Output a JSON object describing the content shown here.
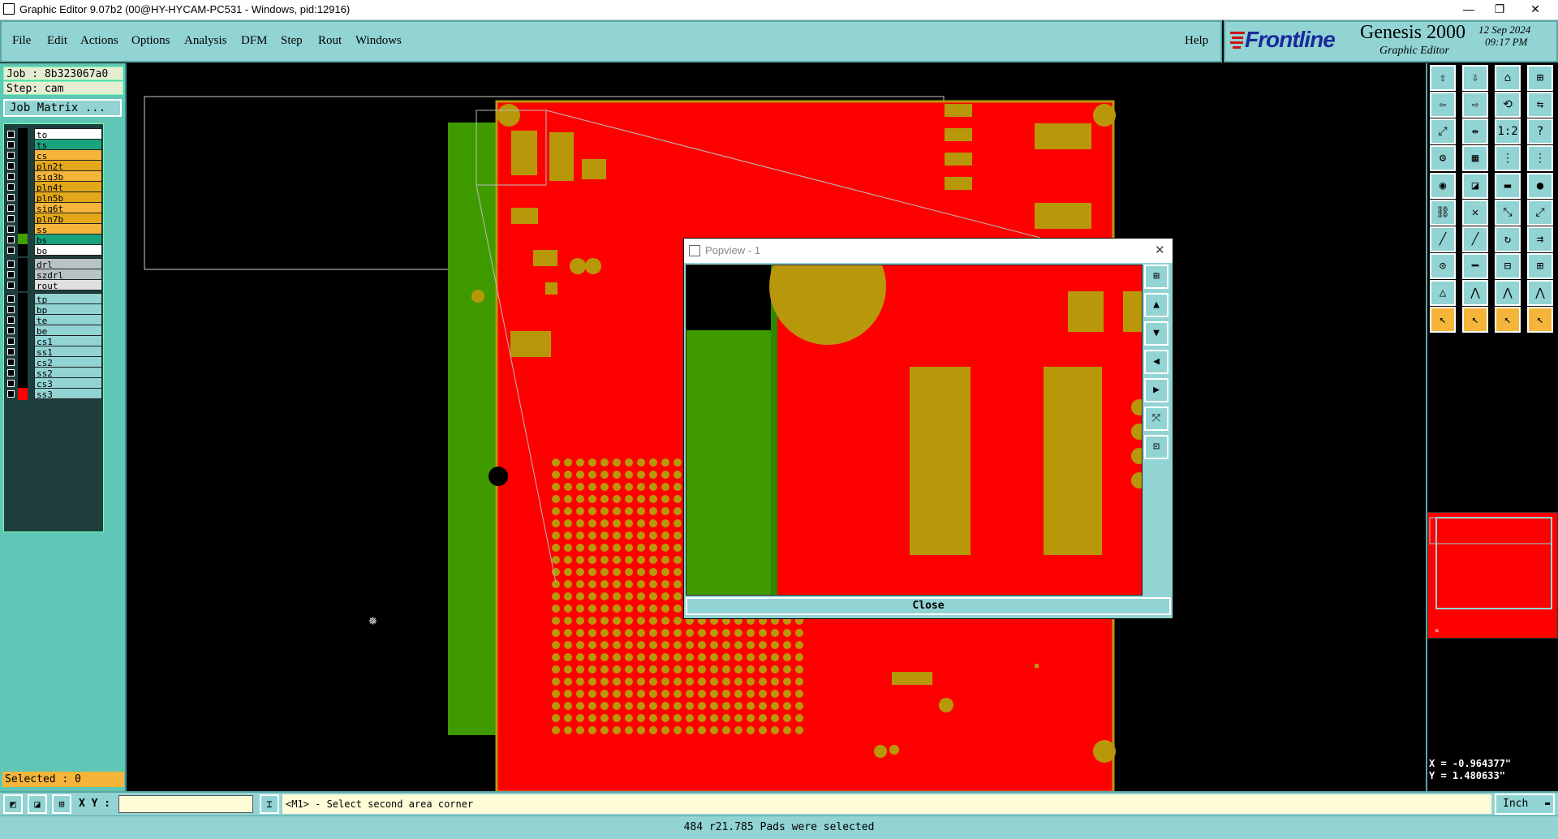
{
  "window": {
    "title": "Graphic Editor 9.07b2 (00@HY-HYCAM-PC531 - Windows, pid:12916)",
    "minimize": "—",
    "restore": "❐",
    "close": "✕"
  },
  "menu": [
    "File",
    "Edit",
    "Actions",
    "Options",
    "Analysis",
    "DFM",
    "Step",
    "Rout",
    "Windows"
  ],
  "help_label": "Help",
  "brand": {
    "logo": "Frontline",
    "product": "Genesis 2000",
    "subtitle": "Graphic Editor",
    "date": "12 Sep 2024",
    "time": "09:17 PM"
  },
  "job": {
    "job_label": "Job : 8b323067a0",
    "step_label": "Step: cam",
    "matrix_button": "Job Matrix ..."
  },
  "layers": [
    {
      "name": "to",
      "color": "#ffffff",
      "swatch": "#000000"
    },
    {
      "name": "ts",
      "color": "#1aa37f",
      "swatch": "#000000"
    },
    {
      "name": "cs",
      "color": "#f5b53a",
      "swatch": "#000000"
    },
    {
      "name": "pln2t",
      "color": "#e3a81a",
      "swatch": "#000000"
    },
    {
      "name": "sig3b",
      "color": "#f5b53a",
      "swatch": "#000000"
    },
    {
      "name": "pln4t",
      "color": "#e3a81a",
      "swatch": "#000000"
    },
    {
      "name": "pln5b",
      "color": "#e3a81a",
      "swatch": "#000000"
    },
    {
      "name": "sig6t",
      "color": "#f5b53a",
      "swatch": "#000000"
    },
    {
      "name": "pln7b",
      "color": "#e3a81a",
      "swatch": "#000000"
    },
    {
      "name": "ss",
      "color": "#f5b53a",
      "swatch": "#000000"
    },
    {
      "name": "bs",
      "color": "#1aa37f",
      "swatch": "#40a000"
    },
    {
      "name": "bo",
      "color": "#ffffff",
      "swatch": "#000000"
    },
    {
      "name": "drl",
      "color": "#b8c4c4",
      "swatch": "#000000"
    },
    {
      "name": "szdrl",
      "color": "#b8c4c4",
      "swatch": "#000000"
    },
    {
      "name": "rout",
      "color": "#e0e0e0",
      "swatch": "#000000"
    },
    {
      "name": "tp",
      "color": "#92d3d3",
      "swatch": "#000000"
    },
    {
      "name": "bp",
      "color": "#92d3d3",
      "swatch": "#000000"
    },
    {
      "name": "te",
      "color": "#92d3d3",
      "swatch": "#000000"
    },
    {
      "name": "be",
      "color": "#92d3d3",
      "swatch": "#000000"
    },
    {
      "name": "cs1",
      "color": "#92d3d3",
      "swatch": "#000000"
    },
    {
      "name": "ss1",
      "color": "#92d3d3",
      "swatch": "#000000"
    },
    {
      "name": "cs2",
      "color": "#92d3d3",
      "swatch": "#000000"
    },
    {
      "name": "ss2",
      "color": "#92d3d3",
      "swatch": "#000000"
    },
    {
      "name": "cs3",
      "color": "#92d3d3",
      "swatch": "#000000"
    },
    {
      "name": "ss3",
      "color": "#92d3d3",
      "swatch": "#ff0000"
    }
  ],
  "selected_label": "Selected : 0",
  "popview": {
    "title": "Popview - 1",
    "close_label": "Close"
  },
  "coords": {
    "x": "X = -0.964377\"",
    "y": "Y = 1.480633\""
  },
  "cmd": {
    "xy_label": "X Y :",
    "xy_value": "",
    "prompt": "<M1> - Select second area corner",
    "units": "Inch"
  },
  "status": "484 r21.785 Pads were selected",
  "colors": {
    "board": "#ff0000",
    "copper": "#b8980a",
    "mask": "#3f9a00",
    "panel": "#92d3d3"
  }
}
